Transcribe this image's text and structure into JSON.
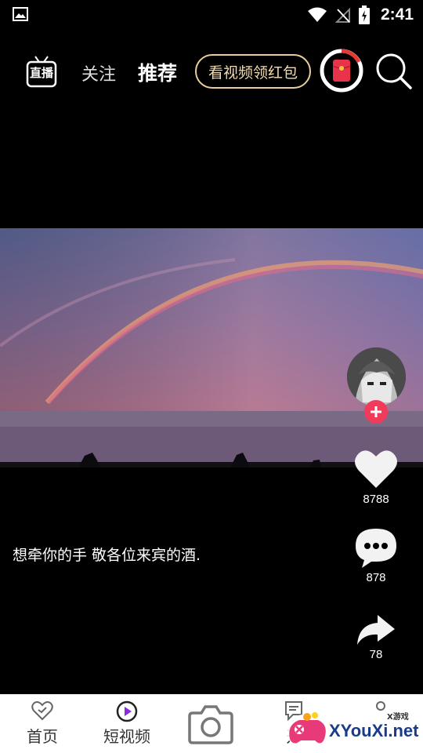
{
  "status_bar": {
    "time": "2:41"
  },
  "top_nav": {
    "live_label": "直播",
    "follow_tab": "关注",
    "recommend_tab": "推荐",
    "redpacket_button": "看视频领红包"
  },
  "video": {
    "caption": "想牵你的手 敬各位来宾的酒."
  },
  "actions": {
    "likes": "8788",
    "comments": "878",
    "shares": "78"
  },
  "tabs": [
    {
      "label": "首页"
    },
    {
      "label": "短视频"
    },
    {
      "label": "开"
    }
  ],
  "watermark": {
    "text": "XYouXi.net",
    "sub": "X游戏"
  },
  "colors": {
    "accent_red": "#f23a5b",
    "gold": "#e8cf9c",
    "redpacket": "#e8334a"
  }
}
